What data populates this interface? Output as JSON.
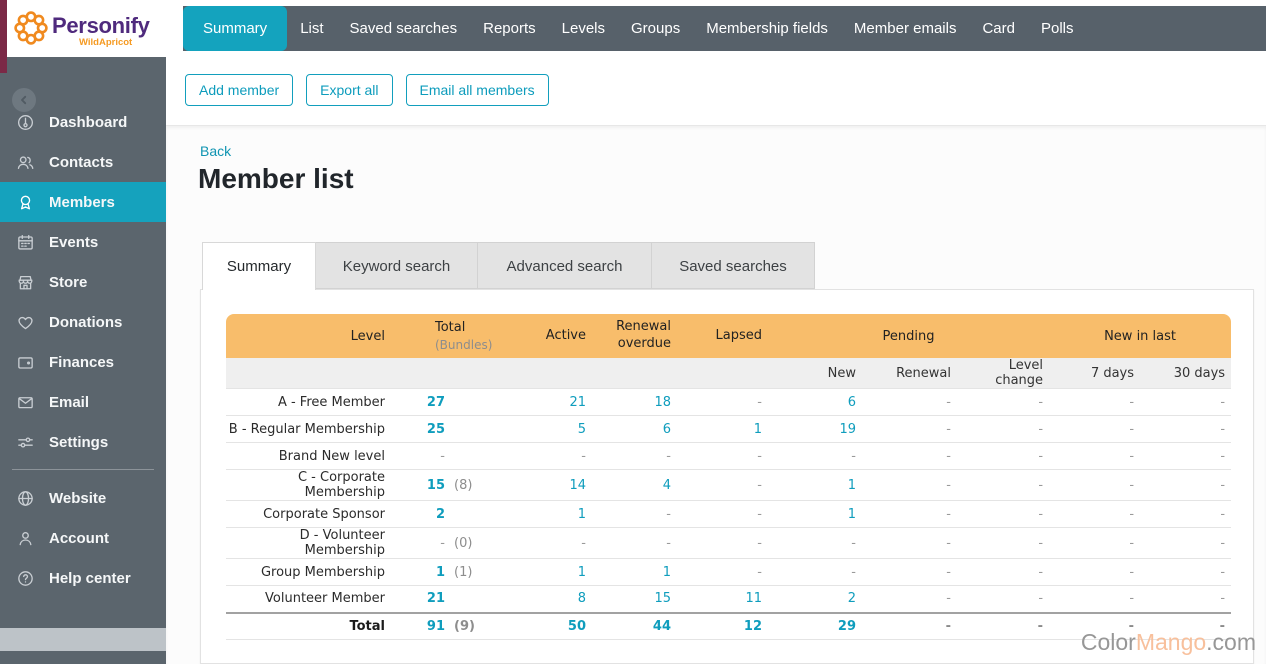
{
  "logo": {
    "brand": "Personify",
    "sub": "WildApricot"
  },
  "top_nav": {
    "items": [
      {
        "label": "Summary",
        "active": true
      },
      {
        "label": "List"
      },
      {
        "label": "Saved searches"
      },
      {
        "label": "Reports"
      },
      {
        "label": "Levels"
      },
      {
        "label": "Groups"
      },
      {
        "label": "Membership fields"
      },
      {
        "label": "Member emails"
      },
      {
        "label": "Card"
      },
      {
        "label": "Polls"
      }
    ]
  },
  "actions": {
    "buttons": [
      "Add member",
      "Export all",
      "Email all members"
    ]
  },
  "sidebar": {
    "items": [
      {
        "label": "Dashboard",
        "icon": "dashboard-gauge-icon"
      },
      {
        "label": "Contacts",
        "icon": "contacts-people-icon"
      },
      {
        "label": "Members",
        "icon": "member-badge-icon",
        "active": true
      },
      {
        "label": "Events",
        "icon": "calendar-icon"
      },
      {
        "label": "Store",
        "icon": "storefront-icon"
      },
      {
        "label": "Donations",
        "icon": "heart-icon"
      },
      {
        "label": "Finances",
        "icon": "wallet-icon"
      },
      {
        "label": "Email",
        "icon": "envelope-icon"
      },
      {
        "label": "Settings",
        "icon": "sliders-icon"
      }
    ],
    "footer_items": [
      {
        "label": "Website",
        "icon": "globe-icon"
      },
      {
        "label": "Account",
        "icon": "person-icon"
      },
      {
        "label": "Help center",
        "icon": "question-circle-icon"
      }
    ]
  },
  "page": {
    "back_link": "Back",
    "title": "Member list"
  },
  "search_tabs": [
    {
      "label": "Summary",
      "active": true
    },
    {
      "label": "Keyword search"
    },
    {
      "label": "Advanced search"
    },
    {
      "label": "Saved searches"
    }
  ],
  "table": {
    "headers": {
      "level": "Level",
      "total": "Total",
      "total_sub": "(Bundles)",
      "active": "Active",
      "renewal_overdue": "Renewal overdue",
      "lapsed": "Lapsed",
      "pending": "Pending",
      "new_in_last": "New in last",
      "sub": [
        "New",
        "Renewal",
        "Level change",
        "7 days",
        "30 days"
      ]
    },
    "rows": [
      {
        "level": "A - Free Member",
        "total": "27",
        "bundles": "",
        "values": [
          "21",
          "18",
          "-",
          "6",
          "-",
          "-",
          "-",
          "-"
        ]
      },
      {
        "level": "B - Regular Membership",
        "total": "25",
        "bundles": "",
        "values": [
          "5",
          "6",
          "1",
          "19",
          "-",
          "-",
          "-",
          "-"
        ]
      },
      {
        "level": "Brand New level",
        "total": "-",
        "bundles": "",
        "values": [
          "-",
          "-",
          "-",
          "-",
          "-",
          "-",
          "-",
          "-"
        ]
      },
      {
        "level": "C - Corporate Membership",
        "total": "15",
        "bundles": "(8)",
        "values": [
          "14",
          "4",
          "-",
          "1",
          "-",
          "-",
          "-",
          "-"
        ]
      },
      {
        "level": "Corporate Sponsor",
        "total": "2",
        "bundles": "",
        "values": [
          "1",
          "-",
          "-",
          "1",
          "-",
          "-",
          "-",
          "-"
        ]
      },
      {
        "level": "D - Volunteer Membership",
        "total": "-",
        "bundles": "(0)",
        "values": [
          "-",
          "-",
          "-",
          "-",
          "-",
          "-",
          "-",
          "-"
        ]
      },
      {
        "level": "Group Membership",
        "total": "1",
        "bundles": "(1)",
        "values": [
          "1",
          "1",
          "-",
          "-",
          "-",
          "-",
          "-",
          "-"
        ]
      },
      {
        "level": "Volunteer Member",
        "total": "21",
        "bundles": "",
        "values": [
          "8",
          "15",
          "11",
          "2",
          "-",
          "-",
          "-",
          "-"
        ]
      }
    ],
    "total_row": {
      "level": "Total",
      "total": "91",
      "bundles": "(9)",
      "values": [
        "50",
        "44",
        "12",
        "29",
        "-",
        "-",
        "-",
        "-"
      ]
    }
  },
  "watermark": {
    "part1": "Color",
    "part2": "Mango",
    "part3": ".com"
  },
  "colors": {
    "teal": "#15a2bd",
    "nav_dark": "#57616a",
    "sidebar_gray": "#5b656d",
    "header_orange": "#f8bd6b",
    "maroon_strip": "#7b2946",
    "number_teal": "#0f9dbd",
    "brand_purple": "#4f2a7d",
    "brand_orange": "#f59a22"
  }
}
